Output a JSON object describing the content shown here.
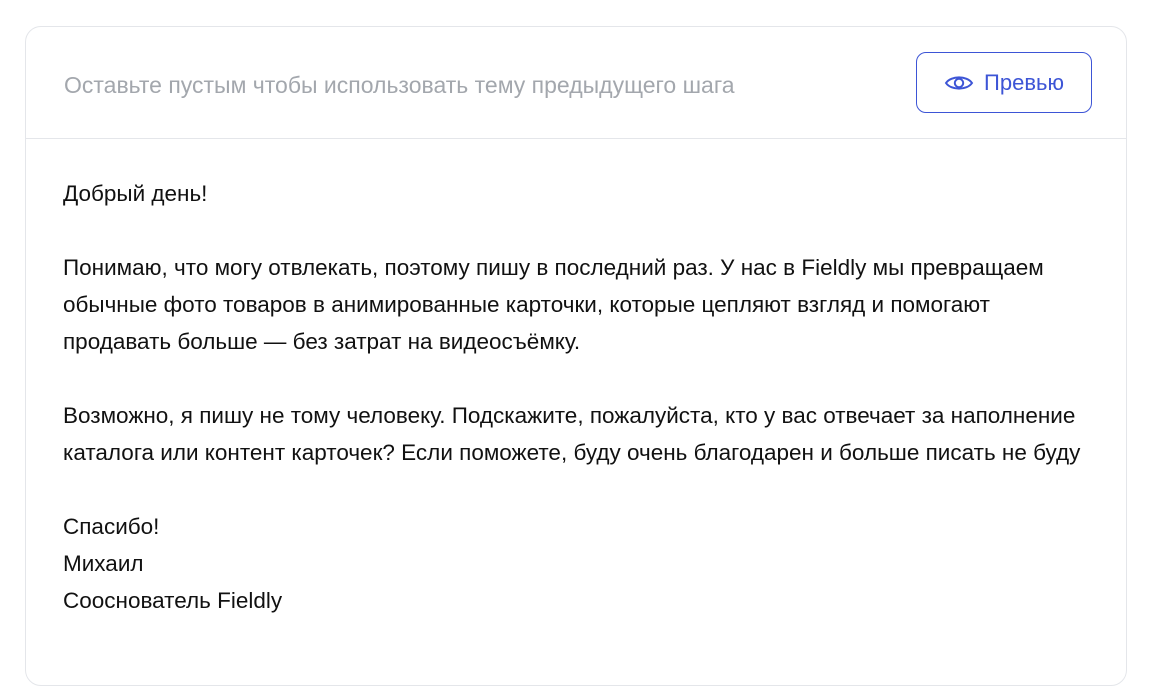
{
  "subject": {
    "value": "",
    "placeholder": "Оставьте пустым чтобы использовать тему предыдущего шага"
  },
  "preview_button": {
    "label": "Превью",
    "icon": "eye-icon",
    "color": "#3d55d6"
  },
  "message": {
    "greeting": "Добрый день!",
    "paragraph_1": "Понимаю, что могу отвлекать, поэтому пишу в последний раз. У нас в Fieldly мы превращаем обычные фото товаров в анимированные карточки, которые цепляют взгляд и помогают продавать больше — без затрат на видеосъёмку.",
    "paragraph_2": "Возможно, я пишу не тому человеку. Подскажите, пожалуйста, кто у вас отвечает за наполнение каталога или контент карточек? Если поможете, буду очень благодарен и больше писать не буду",
    "signature": {
      "thanks": "Спасибо!",
      "name": "Михаил",
      "title": "Сооснователь Fieldly"
    }
  }
}
